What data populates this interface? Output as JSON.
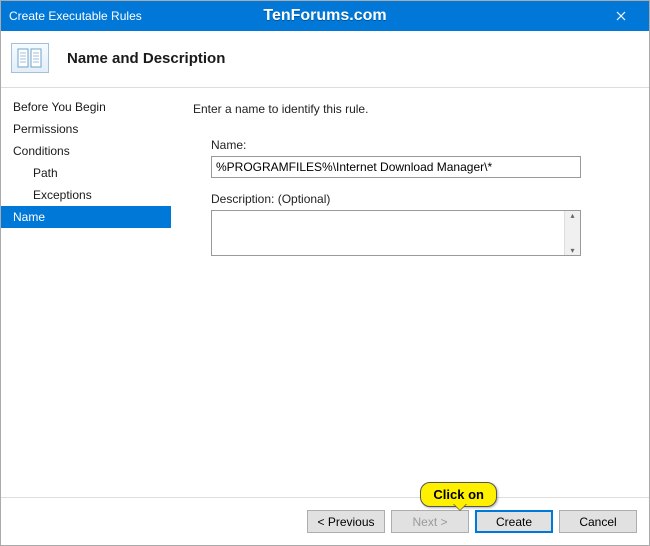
{
  "window": {
    "title": "Create Executable Rules",
    "watermark": "TenForums.com"
  },
  "header": {
    "title": "Name and Description"
  },
  "sidebar": {
    "items": [
      {
        "label": "Before You Begin",
        "child": false,
        "selected": false
      },
      {
        "label": "Permissions",
        "child": false,
        "selected": false
      },
      {
        "label": "Conditions",
        "child": false,
        "selected": false
      },
      {
        "label": "Path",
        "child": true,
        "selected": false
      },
      {
        "label": "Exceptions",
        "child": true,
        "selected": false
      },
      {
        "label": "Name",
        "child": false,
        "selected": true
      }
    ]
  },
  "form": {
    "instruction": "Enter a name to identify this rule.",
    "name_label": "Name:",
    "name_value": "%PROGRAMFILES%\\Internet Download Manager\\*",
    "description_label": "Description: (Optional)",
    "description_value": ""
  },
  "footer": {
    "previous": "< Previous",
    "next": "Next >",
    "create": "Create",
    "cancel": "Cancel"
  },
  "callout": {
    "text": "Click on"
  }
}
